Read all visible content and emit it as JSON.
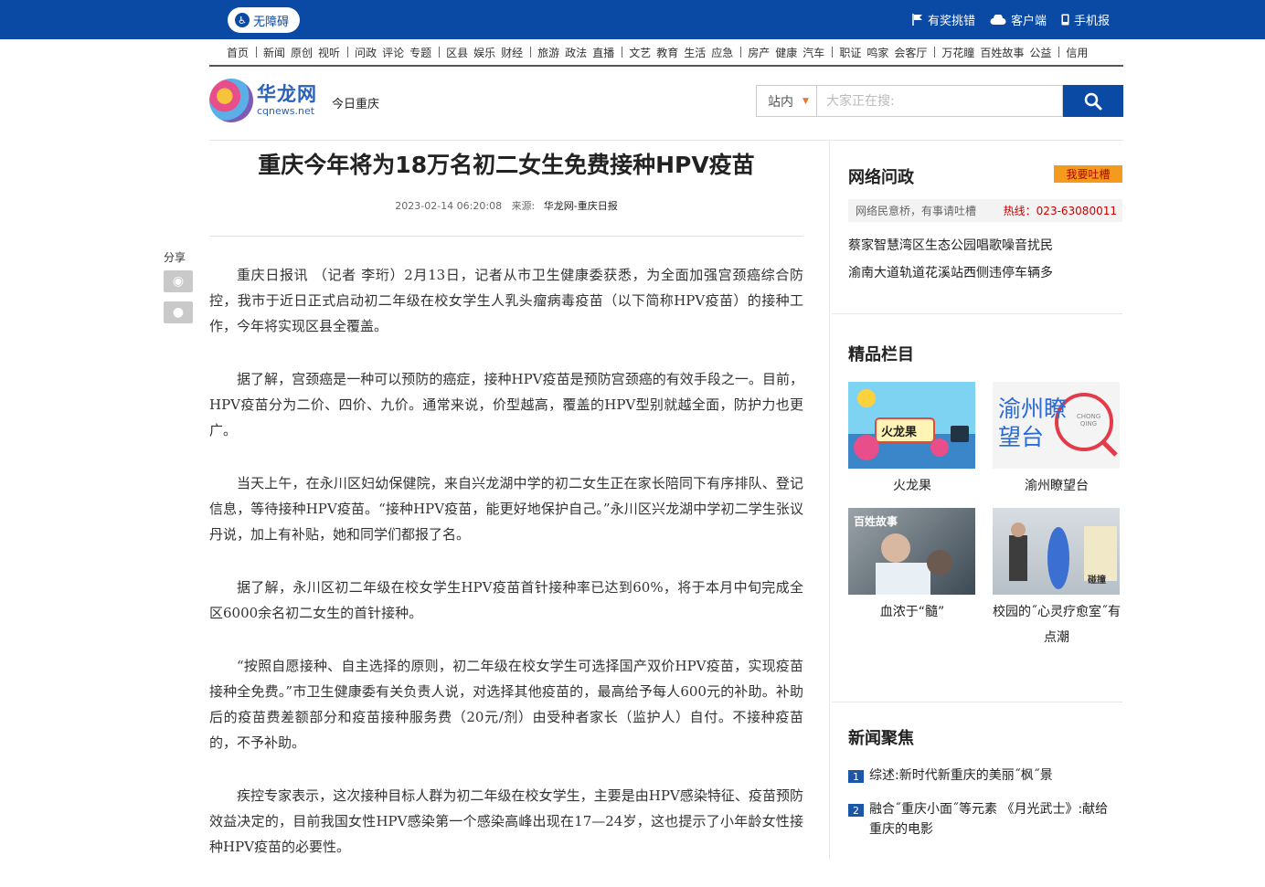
{
  "topbar": {
    "accessibility": "无障碍",
    "links": [
      {
        "label": "有奖挑错",
        "icon": "flag-icon"
      },
      {
        "label": "客户端",
        "icon": "cloud-icon"
      },
      {
        "label": "手机报",
        "icon": "phone-icon"
      }
    ]
  },
  "nav": {
    "groups": [
      [
        "首页"
      ],
      [
        "新闻",
        "原创",
        "视听"
      ],
      [
        "问政",
        "评论",
        "专题"
      ],
      [
        "区县",
        "娱乐",
        "财经"
      ],
      [
        "旅游",
        "政法",
        "直播"
      ],
      [
        "文艺",
        "教育",
        "生活",
        "应急"
      ],
      [
        "房产",
        "健康",
        "汽车"
      ],
      [
        "职证",
        "鸣家",
        "会客厅"
      ],
      [
        "万花瞳",
        "百姓故事",
        "公益"
      ],
      [
        "信用"
      ]
    ]
  },
  "header": {
    "logo_cn": "华龙网",
    "logo_en": "cqnews.net",
    "subtitle": "今日重庆",
    "search_scope": "站内",
    "search_placeholder": "大家正在搜:"
  },
  "article": {
    "title": "重庆今年将为18万名初二女生免费接种HPV疫苗",
    "datetime": "2023-02-14 06:20:08",
    "source_label": "来源:",
    "source": "华龙网-重庆日报",
    "paragraphs": [
      "重庆日报讯 （记者 李珩）2月13日，记者从市卫生健康委获悉，为全面加强宫颈癌综合防控，我市于近日正式启动初二年级在校女学生人乳头瘤病毒疫苗（以下简称HPV疫苗）的接种工作，今年将实现区县全覆盖。",
      "据了解，宫颈癌是一种可以预防的癌症，接种HPV疫苗是预防宫颈癌的有效手段之一。目前，HPV疫苗分为二价、四价、九价。通常来说，价型越高，覆盖的HPV型别就越全面，防护力也更广。",
      "当天上午，在永川区妇幼保健院，来自兴龙湖中学的初二女生正在家长陪同下有序排队、登记信息，等待接种HPV疫苗。“接种HPV疫苗，能更好地保护自己。”永川区兴龙湖中学初二学生张议丹说，加上有补贴，她和同学们都报了名。",
      "据了解，永川区初二年级在校女学生HPV疫苗首针接种率已达到60%，将于本月中旬完成全区6000余名初二女生的首针接种。",
      "“按照自愿接种、自主选择的原则，初二年级在校女学生可选择国产双价HPV疫苗，实现疫苗接种全免费。”市卫生健康委有关负责人说，对选择其他疫苗的，最高给予每人600元的补助。补助后的疫苗费差额部分和疫苗接种服务费（20元/剂）由受种者家长（监护人）自付。不接种疫苗的，不予补助。",
      "疾控专家表示，这次接种目标人群为初二年级在校女学生，主要是由HPV感染特征、疫苗预防效益决定的，目前我国女性HPV感染第一个感染高峰出现在17—24岁，这也提示了小年龄女性接种HPV疫苗的必要性。"
    ]
  },
  "share": {
    "label": "分享"
  },
  "sidebar": {
    "wenzheng": {
      "title": "网络问政",
      "button": "我要吐槽",
      "bar_left": "网络民意桥，有事请吐槽",
      "hotline": "热线：023-63080011",
      "items": [
        "蔡家智慧湾区生态公园唱歌噪音扰民",
        "渝南大道轨道花溪站西侧违停车辆多"
      ]
    },
    "jingpin": {
      "title": "精品栏目",
      "tiles": [
        {
          "caption": "火龙果",
          "badge": "火龙果"
        },
        {
          "caption": "渝州瞭望台",
          "badge": "渝州瞭望台",
          "badge_en": "CHONG QING"
        },
        {
          "caption": "血浓于“髓”",
          "badge": "百姓故事"
        },
        {
          "caption": "校园的˝心灵疗愈室˝有点潮",
          "badge": "碰撞"
        }
      ]
    },
    "focus": {
      "title": "新闻聚焦",
      "items": [
        {
          "num": "1",
          "text": "综述:新时代新重庆的美丽˝枫˝景"
        },
        {
          "num": "2",
          "text": "融合˝重庆小面˝等元素 《月光武士》:献给重庆的电影"
        }
      ]
    }
  },
  "colors": {
    "brand_blue": "#0a4aa4",
    "hotline_red": "#cc0000",
    "button_orange": "#f49b1e"
  }
}
